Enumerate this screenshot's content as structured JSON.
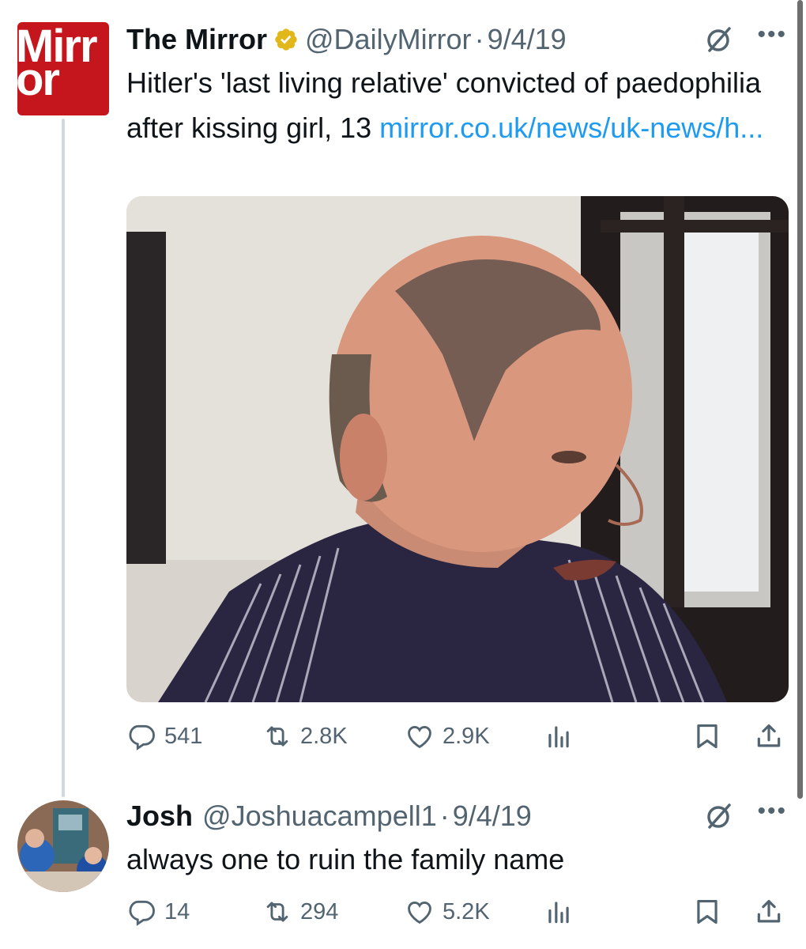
{
  "tweets": [
    {
      "name": "The Mirror",
      "handle": "@DailyMirror",
      "separator": "·",
      "date": "9/4/19",
      "avatar_text_line1": "Mirr",
      "avatar_text_line2": "or",
      "text": "Hitler's 'last living relative' convicted of paedophilia after kissing girl, 13 ",
      "link": "mirror.co.uk/news/uk-news/h...",
      "stats": {
        "replies": "541",
        "reposts": "2.8K",
        "likes": "2.9K"
      }
    },
    {
      "name": "Josh",
      "handle": "@Joshuacampell1",
      "separator": "·",
      "date": "9/4/19",
      "text": "always one to ruin the family name",
      "stats": {
        "replies": "14",
        "reposts": "294",
        "likes": "5.2K"
      }
    }
  ],
  "icons": {
    "reply": "reply-icon",
    "repost": "repost-icon",
    "like": "heart-icon",
    "views": "views-icon",
    "bookmark": "bookmark-icon",
    "share": "share-icon",
    "grok": "grok-icon",
    "more": "more-icon",
    "verified": "verified-badge-icon"
  },
  "colors": {
    "link": "#1d9bf0",
    "muted": "#536471",
    "brand_red": "#c4161c",
    "verified_gold": "#e2b719"
  }
}
